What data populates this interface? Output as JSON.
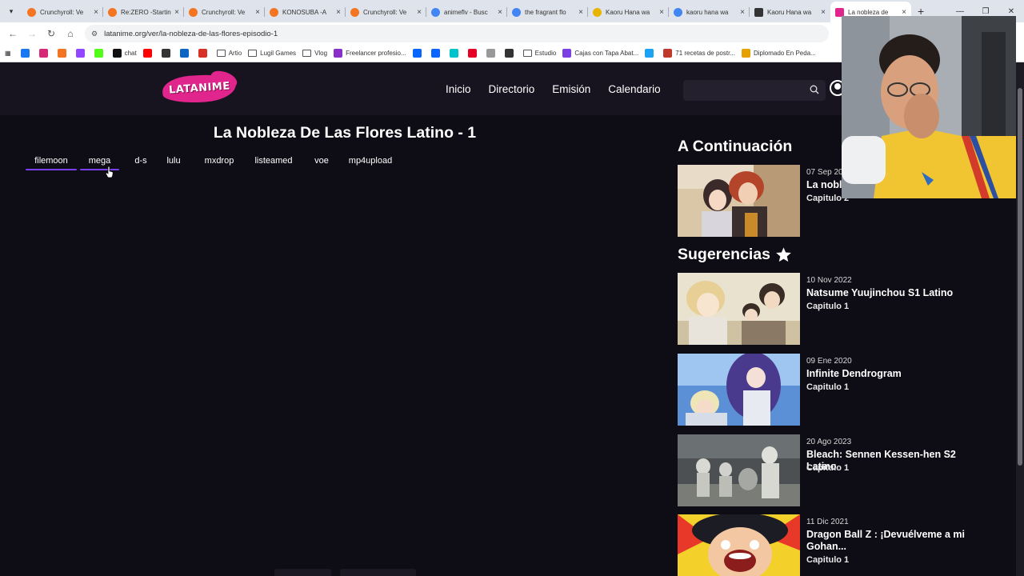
{
  "browser": {
    "tabs": [
      {
        "label": "Crunchyroll: Ve",
        "color": "#f47521"
      },
      {
        "label": "Re:ZERO -Startin",
        "color": "#f47521"
      },
      {
        "label": "Crunchyroll: Ve",
        "color": "#f47521"
      },
      {
        "label": "KONOSUBA -A",
        "color": "#f47521"
      },
      {
        "label": "Crunchyroll: Ve",
        "color": "#f47521"
      },
      {
        "label": "animeflv - Busc",
        "color": "#4285f4"
      },
      {
        "label": "the fragrant flo",
        "color": "#4285f4"
      },
      {
        "label": "Kaoru Hana wa",
        "color": "#e8b400"
      },
      {
        "label": "kaoru hana wa",
        "color": "#4285f4"
      },
      {
        "label": "Kaoru Hana wa",
        "color": "#333333"
      },
      {
        "label": "La nobleza de",
        "color": "#e0258c"
      }
    ],
    "url": "latanime.org/ver/la-nobleza-de-las-flores-episodio-1",
    "bookmarks": [
      {
        "label": "",
        "icon": "facebook-icon",
        "color": "#1877f2"
      },
      {
        "label": "",
        "icon": "instagram-icon",
        "color": "#d62976"
      },
      {
        "label": "",
        "icon": "crunchyroll-icon",
        "color": "#f47521"
      },
      {
        "label": "",
        "icon": "twitch-icon",
        "color": "#9146ff"
      },
      {
        "label": "",
        "icon": "kick-icon",
        "color": "#53fc18"
      },
      {
        "label": "chat",
        "icon": "kick-chat-icon",
        "color": "#111111"
      },
      {
        "label": "",
        "icon": "youtube-icon",
        "color": "#ff0000"
      },
      {
        "label": "",
        "icon": "threads-icon",
        "color": "#333333"
      },
      {
        "label": "",
        "icon": "linkedin-icon",
        "color": "#0a66c2"
      },
      {
        "label": "",
        "icon": "gmail-icon",
        "color": "#d93025"
      },
      {
        "label": "Artio",
        "icon": "folder-icon",
        "color": ""
      },
      {
        "label": "Lugil Games",
        "icon": "folder-icon",
        "color": ""
      },
      {
        "label": "Vlog",
        "icon": "folder-icon",
        "color": ""
      },
      {
        "label": "Freelancer profesio...",
        "icon": "freelancer-icon",
        "color": "#8b2fc9"
      },
      {
        "label": "",
        "icon": "meta-icon",
        "color": "#0866ff"
      },
      {
        "label": "",
        "icon": "meta-icon",
        "color": "#0866ff"
      },
      {
        "label": "",
        "icon": "canva-icon",
        "color": "#00c4cc"
      },
      {
        "label": "",
        "icon": "pinterest-icon",
        "color": "#e60023"
      },
      {
        "label": "",
        "icon": "mercadolibre-icon",
        "color": "#999999"
      },
      {
        "label": "",
        "icon": "stack-icon",
        "color": "#333333"
      },
      {
        "label": "Estudio",
        "icon": "folder-icon",
        "color": ""
      },
      {
        "label": "Cajas con Tapa Abat...",
        "icon": "cajas-icon",
        "color": "#7b3fe4"
      },
      {
        "label": "",
        "icon": "bird-icon",
        "color": "#1da1f2"
      },
      {
        "label": "71 recetas de postr...",
        "icon": "recetas-icon",
        "color": "#c0392b"
      },
      {
        "label": "Diplomado En Peda...",
        "icon": "diplomado-icon",
        "color": "#e6a100"
      }
    ]
  },
  "site": {
    "logo_text": "LATANIME",
    "nav": [
      "Inicio",
      "Directorio",
      "Emisión",
      "Calendario"
    ],
    "search_placeholder": "",
    "episode_title": "La Nobleza De Las Flores Latino - 1",
    "servers": [
      "filemoon",
      "mega",
      "d-s",
      "lulu",
      "mxdrop",
      "listeamed",
      "voe",
      "mp4upload"
    ],
    "active_server": "filemoon",
    "hover_server": "mega",
    "next_heading": "A Continuación",
    "next": {
      "date": "07 Sep 20",
      "title": "La nobl",
      "chapter": "Capitulo 2"
    },
    "suggest_heading": "Sugerencias",
    "suggestions": [
      {
        "date": "10 Nov 2022",
        "title": "Natsume Yuujinchou S1 Latino",
        "chapter": "Capitulo 1"
      },
      {
        "date": "09 Ene 2020",
        "title": "Infinite Dendrogram",
        "chapter": "Capitulo 1"
      },
      {
        "date": "20 Ago 2023",
        "title": "Bleach: Sennen Kessen-hen S2 Latino",
        "chapter": "Capitulo 1"
      },
      {
        "date": "11 Dic 2021",
        "title": "Dragon Ball Z : ¡Devuélveme a mi Gohan...",
        "chapter": "Capitulo 1"
      }
    ]
  },
  "colors": {
    "accent": "#7a3ff2",
    "brand": "#e0258c",
    "background": "#0e0c14",
    "header": "#17141f"
  }
}
